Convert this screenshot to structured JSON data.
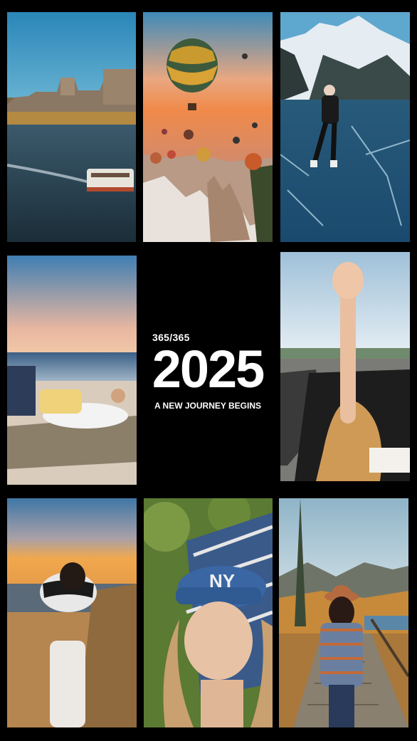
{
  "center": {
    "counter": "365/365",
    "year": "2025",
    "tagline": "A NEW JOURNEY BEGINS"
  },
  "tiles": [
    {
      "name": "city-river-boat-photo"
    },
    {
      "name": "hot-air-balloons-photo"
    },
    {
      "name": "ice-skating-mountain-photo"
    },
    {
      "name": "beach-lying-sunset-photo"
    },
    {
      "name": "convertible-wave-photo"
    },
    {
      "name": "beach-walk-sunset-photo"
    },
    {
      "name": "cap-portrait-photo"
    },
    {
      "name": "forest-boardwalk-photo"
    }
  ]
}
